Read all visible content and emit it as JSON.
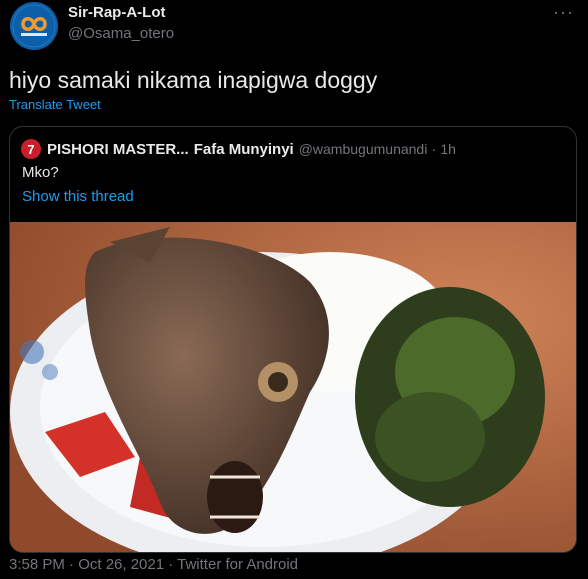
{
  "author": {
    "display_name": "Sir-Rap-A-Lot",
    "handle": "@Osama_otero",
    "avatar_icon": "infinity-logo-icon"
  },
  "more_icon": "···",
  "tweet": {
    "text": "hiyo samaki nikama inapigwa doggy",
    "translate_label": "Translate Tweet"
  },
  "quote": {
    "avatar_glyph": "7",
    "name": "PISHORI MASTER...",
    "name2": "Fafa Munyinyi",
    "handle": "@wambugumunandi",
    "dot": "·",
    "time": "1h",
    "text": "Mko?",
    "show_thread": "Show this thread",
    "image_icon": "fish-meal-photo"
  },
  "meta": {
    "text": "3:58 PM · Oct 26, 2021 · Twitter for Android"
  },
  "colors": {
    "background": "#000000",
    "text": "#e7e9ea",
    "muted": "#71767b",
    "link": "#1d9bf0",
    "border": "#2f3336"
  }
}
